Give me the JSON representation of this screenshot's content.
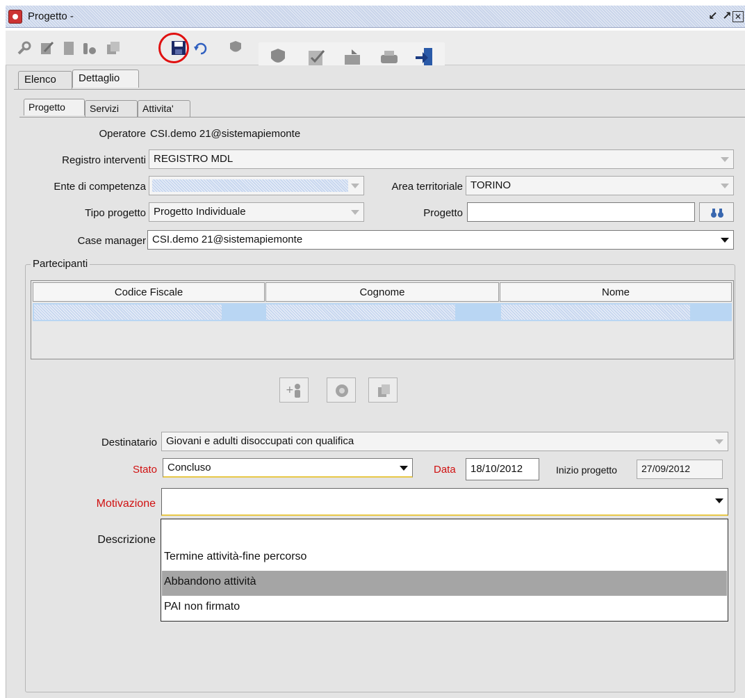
{
  "window": {
    "title": "Progetto -"
  },
  "tabs": {
    "outer": [
      "Elenco",
      "Dettaglio"
    ],
    "inner": [
      "Progetto",
      "Servizi",
      "Attivita'"
    ]
  },
  "form": {
    "operatore_label": "Operatore",
    "operatore_value": "CSI.demo 21@sistemapiemonte",
    "registro_label": "Registro interventi",
    "registro_value": "REGISTRO MDL",
    "ente_label": "Ente di competenza",
    "area_label": "Area territoriale",
    "area_value": "TORINO",
    "tipo_label": "Tipo progetto",
    "tipo_value": "Progetto Individuale",
    "progetto_label": "Progetto",
    "progetto_value": "",
    "case_manager_label": "Case manager",
    "case_manager_value": "CSI.demo 21@sistemapiemonte"
  },
  "partecipanti": {
    "legend": "Partecipanti",
    "columns": [
      "Codice Fiscale",
      "Cognome",
      "Nome"
    ]
  },
  "detail": {
    "destinatario_label": "Destinatario",
    "destinatario_value": "Giovani e adulti disoccupati con qualifica",
    "stato_label": "Stato",
    "stato_value": "Concluso",
    "data_label": "Data",
    "data_value": "18/10/2012",
    "inizio_label": "Inizio progetto",
    "inizio_value": "27/09/2012",
    "motivazione_label": "Motivazione",
    "motivazione_value": "",
    "descrizione_label": "Descrizione"
  },
  "motivazione_options": [
    "",
    "Termine attività-fine percorso",
    "Abbandono attività",
    "PAI non firmato"
  ],
  "highlighted_option_index": 2,
  "colors": {
    "required_label": "#d01010",
    "selection": "#b9d6f3",
    "highlight_circle": "#e01010"
  },
  "icons": {
    "toolbar": [
      "search-icon",
      "edit-icon",
      "new-document-icon",
      "binoculars-icon",
      "copy-icon",
      "save-icon",
      "undo-icon",
      "shield-icon",
      "shield-icon",
      "checklist-icon",
      "export-icon",
      "print-icon",
      "exit-icon"
    ],
    "search_button": "binoculars-icon",
    "participants_actions": [
      "add-person-icon",
      "remove-icon",
      "duplicate-icon"
    ]
  }
}
